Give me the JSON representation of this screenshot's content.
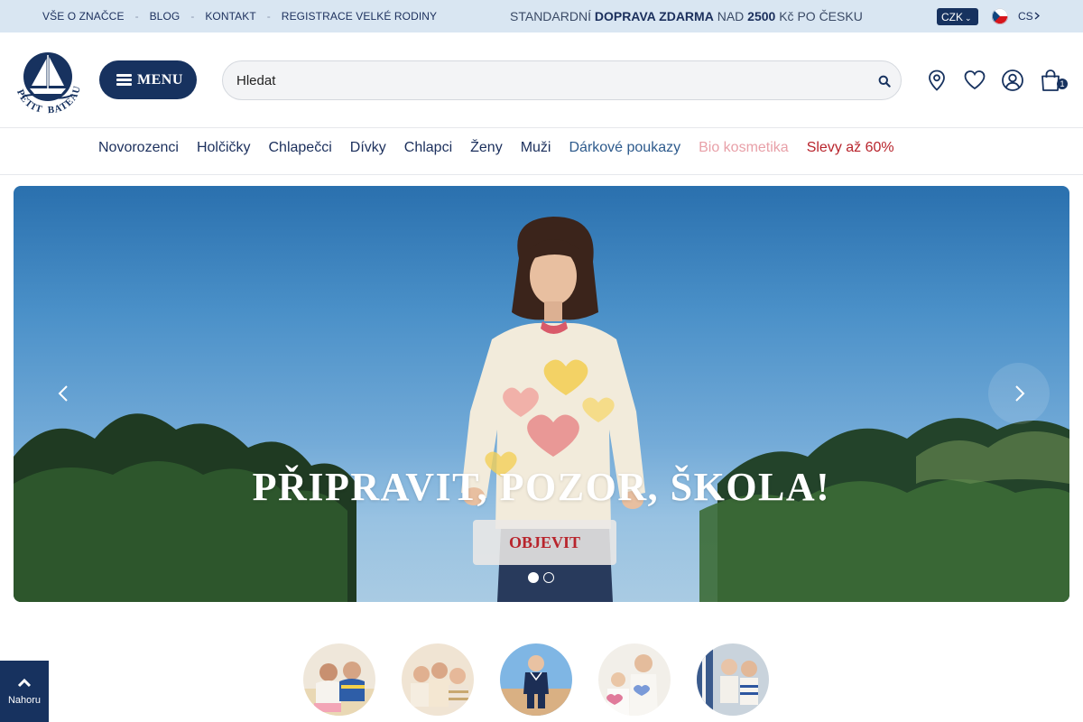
{
  "topbar": {
    "links": [
      "VŠE O ZNAČCE",
      "BLOG",
      "KONTAKT",
      "REGISTRACE VELKÉ RODINY"
    ],
    "separator": "-",
    "shipping_prefix": "STANDARDNÍ",
    "shipping_bold": "DOPRAVA ZDARMA",
    "shipping_mid": "NAD",
    "shipping_amount": "2500",
    "shipping_suffix": "Kč PO ČESKU",
    "currency": "CZK",
    "language": "CS"
  },
  "header": {
    "logo_text_left": "PETIT",
    "logo_text_right": "BATEAU",
    "menu_label": "MENU",
    "search_placeholder": "Hledat",
    "cart_count": "1",
    "icons": [
      "store-locator-icon",
      "wishlist-heart-icon",
      "account-icon",
      "cart-bag-icon",
      "search-icon"
    ]
  },
  "nav": {
    "items": [
      "Novorozenci",
      "Holčičky",
      "Chlapečci",
      "Dívky",
      "Chlapci",
      "Ženy",
      "Muži",
      "Dárkové poukazy",
      "Bio kosmetika",
      "Slevy až 60%"
    ]
  },
  "hero": {
    "title": "PŘIPRAVIT, POZOR, ŠKOLA!",
    "cta": "OBJEVIT",
    "slides": 2,
    "active_slide": 1
  },
  "back_to_top": {
    "label": "Nahoru"
  },
  "colors": {
    "brand_navy": "#17325f",
    "topbar_bg": "#d9e6f2",
    "sale_red": "#b8242c",
    "bio_pink": "#e8a0a8"
  }
}
